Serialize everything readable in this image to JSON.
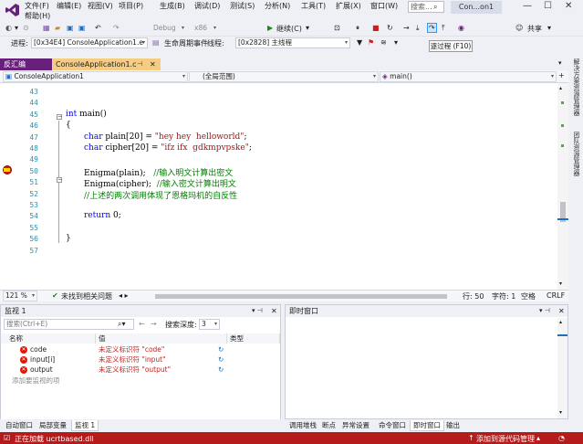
{
  "menu": {
    "items": [
      "文件(F)",
      "编辑(E)",
      "视图(V)",
      "项目(P)",
      "生成(B)",
      "调试(D)",
      "测试(S)",
      "分析(N)",
      "工具(T)",
      "扩展(X)",
      "窗口(W)"
    ],
    "help": "帮助(H)",
    "search_placeholder": "搜索...",
    "project_title": "Con...on1"
  },
  "toolbar": {
    "config": "Debug",
    "platform": "x86",
    "continue": "继续(C)",
    "share": "共享",
    "process_label": "进程:",
    "process_value": "[0x34E4] ConsoleApplication1.e",
    "lifecycle": "生命周期事件",
    "thread_label": "线程:",
    "thread_value": "[0x2828] 主线程",
    "tooltip": "逐过程 (F10)"
  },
  "tabs": {
    "disasm": "反汇编",
    "file": "ConsoleApplication1.c"
  },
  "navbar": {
    "project": "ConsoleApplication1",
    "scope": "(全局范围)",
    "func": "main()"
  },
  "side": {
    "solution_explorer": "解决方案资源管理器",
    "team_explorer": "团队资源管理器"
  },
  "code": {
    "lines": [
      {
        "n": "43",
        "t": ""
      },
      {
        "n": "44",
        "t": ""
      },
      {
        "n": "45",
        "kw": "int",
        "t": " main()"
      },
      {
        "n": "46",
        "t": "{"
      },
      {
        "n": "47",
        "kw": "char",
        "t": " plain[20] = ",
        "str": "\"hey hey  helloworld\"",
        "end": ";"
      },
      {
        "n": "48",
        "kw": "char",
        "t": " cipher[20] = ",
        "str": "\"ifz ifx  gdkmpvpske\"",
        "end": ";"
      },
      {
        "n": "49",
        "t": ""
      },
      {
        "n": "50",
        "t": "Enigma(plain);   ",
        "cm": "//输入明文计算出密文"
      },
      {
        "n": "51",
        "t": "Enigma(cipher);  ",
        "cm": "//输入密文计算出明文"
      },
      {
        "n": "52",
        "t": "",
        "cm": "//上述的两次调用体现了恩格玛机的自反性"
      },
      {
        "n": "53",
        "t": ""
      },
      {
        "n": "54",
        "kw": "return",
        "t": " 0;"
      },
      {
        "n": "55",
        "t": ""
      },
      {
        "n": "56",
        "t": "}"
      },
      {
        "n": "57",
        "t": ""
      }
    ]
  },
  "status": {
    "zoom": "121 %",
    "issues": "未找到相关问题",
    "row": "行: 50",
    "col": "字符: 1",
    "space": "空格",
    "eol": "CRLF"
  },
  "watch": {
    "title": "监视 1",
    "search_placeholder": "搜索(Ctrl+E)",
    "depth_label": "搜索深度:",
    "depth": "3",
    "col_name": "名称",
    "col_value": "值",
    "col_type": "类型",
    "rows": [
      {
        "name": "code",
        "value": "未定义标识符 \"code\""
      },
      {
        "name": "input[i]",
        "value": "未定义标识符 \"input\""
      },
      {
        "name": "output",
        "value": "未定义标识符 \"output\""
      }
    ],
    "add_item": "添加要监视的项"
  },
  "immediate": {
    "title": "即时窗口"
  },
  "bottom_tabs_left": [
    "自动窗口",
    "局部变量",
    "监视 1"
  ],
  "bottom_tabs_right": [
    "调用堆栈",
    "断点",
    "异常设置",
    "命令窗口",
    "即时窗口",
    "输出"
  ],
  "footer": {
    "loading": "正在加载 ucrtbased.dll",
    "source_control": "添加到源代码管理"
  },
  "colors": {
    "accent": "#68217a",
    "tab_active": "#f5cc84",
    "footer": "#b51b1b"
  }
}
